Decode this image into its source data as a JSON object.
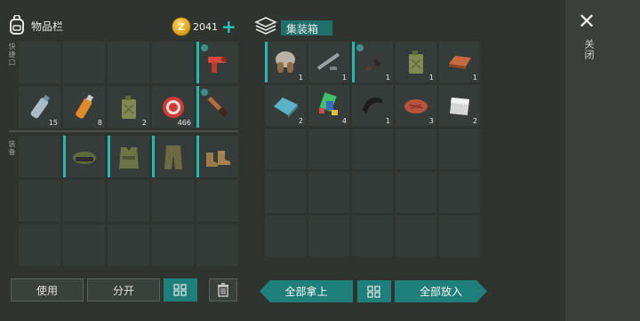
{
  "inventory": {
    "title": "物品栏",
    "coins": "2041",
    "coin_symbol": "Z",
    "plus_label": "+",
    "hotbar_label": "快捷口",
    "equip_label": "装备",
    "grid": [
      {
        "icon": "",
        "count": ""
      },
      {
        "icon": "",
        "count": ""
      },
      {
        "icon": "",
        "count": ""
      },
      {
        "icon": "",
        "count": ""
      },
      {
        "icon": "flare-gun-icon",
        "count": "",
        "selected": true,
        "badge": true
      },
      {
        "icon": "water-bottle-icon",
        "count": "15"
      },
      {
        "icon": "orange-bottle-icon",
        "count": "8"
      },
      {
        "icon": "jerrycan-icon",
        "count": "2"
      },
      {
        "icon": "bottle-cap-icon",
        "count": "466"
      },
      {
        "icon": "knife-icon",
        "count": "",
        "selected": true,
        "badge": true
      }
    ],
    "equipment": [
      {
        "icon": "",
        "count": ""
      },
      {
        "icon": "cap-goggles-icon",
        "count": "",
        "selected": true
      },
      {
        "icon": "vest-armor-icon",
        "count": "",
        "selected": true
      },
      {
        "icon": "cargo-pants-icon",
        "count": "",
        "selected": true
      },
      {
        "icon": "boots-icon",
        "count": "",
        "selected": true
      }
    ],
    "buttons": {
      "use": "使用",
      "split": "分开",
      "arrange_icon": "grid-arrange-icon",
      "trash_icon": "trash-icon"
    }
  },
  "container": {
    "title": "集装箱",
    "items": [
      {
        "icon": "fur-hat-icon",
        "count": "1",
        "selected": true
      },
      {
        "icon": "pipe-scrap-icon",
        "count": "1"
      },
      {
        "icon": "rifle-icon",
        "count": "1",
        "selected": true,
        "badge": true
      },
      {
        "icon": "jerrycan-icon",
        "count": "1"
      },
      {
        "icon": "copper-ingot-icon",
        "count": "1"
      },
      {
        "icon": "glass-pane-icon",
        "count": "2"
      },
      {
        "icon": "cards-pile-icon",
        "count": "4"
      },
      {
        "icon": "rubber-sheet-icon",
        "count": "1"
      },
      {
        "icon": "raw-meat-icon",
        "count": "3"
      },
      {
        "icon": "metal-plate-icon",
        "count": "2"
      }
    ],
    "buttons": {
      "take_all": "全部拿上",
      "arrange_icon": "grid-arrange-icon",
      "put_all": "全部放入"
    }
  },
  "sidebar": {
    "close_icon": "close-icon",
    "label": "关闭"
  },
  "colors": {
    "accent": "#27b9ad",
    "panel": "#363c39",
    "background": "#2f3431"
  }
}
